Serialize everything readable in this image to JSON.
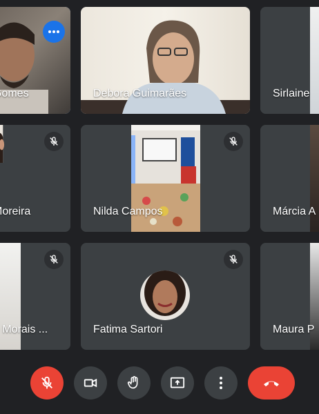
{
  "participants": [
    {
      "name": "Gomes"
    },
    {
      "name": "Debora Guimarães"
    },
    {
      "name": "Sirlaine"
    },
    {
      "name": "Moreira"
    },
    {
      "name": "Nilda Campos"
    },
    {
      "name": "Márcia A"
    },
    {
      "name": "o Morais ..."
    },
    {
      "name": "Fatima Sartori"
    },
    {
      "name": "Maura P"
    }
  ],
  "icons": {
    "mic_off": "mic-off-icon",
    "camera": "camera-icon",
    "hand": "raise-hand-icon",
    "present": "present-screen-icon",
    "more": "more-options-icon",
    "end": "end-call-icon"
  },
  "colors": {
    "background": "#202124",
    "tile": "#3c4043",
    "active_border": "#8ab4f8",
    "accent_blue": "#1a73e8",
    "danger": "#ea4335"
  }
}
